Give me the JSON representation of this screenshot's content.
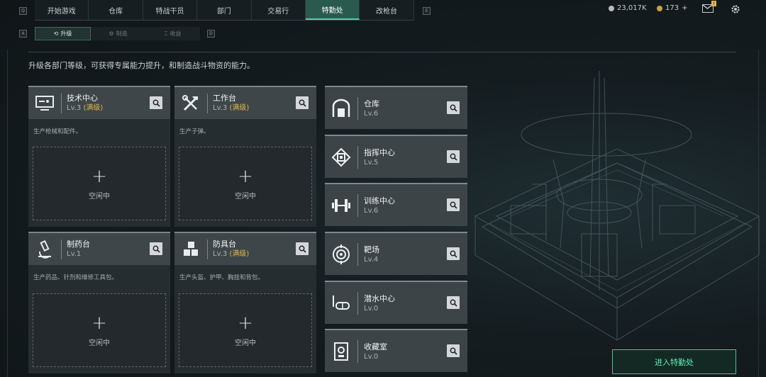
{
  "key_hints": {
    "left_tab": "Q",
    "right_tab": "E",
    "left_sub": "A",
    "right_sub": "D"
  },
  "top_tabs": [
    {
      "label": "开始游戏",
      "active": false
    },
    {
      "label": "仓库",
      "active": false
    },
    {
      "label": "特战干员",
      "active": false
    },
    {
      "label": "部门",
      "active": false
    },
    {
      "label": "交易行",
      "active": false
    },
    {
      "label": "特勤处",
      "active": true
    },
    {
      "label": "改枪台",
      "active": false
    }
  ],
  "currency": {
    "coins": "23,017K",
    "tickets": "173",
    "tickets_plus": "+",
    "mail_badge": "!"
  },
  "sub_tabs": [
    {
      "label": "升级",
      "icon": "upgrade-icon",
      "active": true
    },
    {
      "label": "制造",
      "icon": "craft-icon",
      "active": false
    },
    {
      "label": "收益",
      "icon": "income-icon",
      "active": false
    }
  ],
  "description": "升级各部门等级，可获得专属能力提升，和制造战斗物资的能力。",
  "production_cards": [
    {
      "name": "技术中心",
      "level": "Lv.3",
      "max_label": "(满级)",
      "desc": "生产枪械和配件。",
      "icon": "monitor-icon",
      "status": "空闲中"
    },
    {
      "name": "工作台",
      "level": "Lv.3",
      "max_label": "(满级)",
      "desc": "生产子弹。",
      "icon": "tools-icon",
      "status": "空闲中"
    },
    {
      "name": "制药台",
      "level": "Lv.1",
      "max_label": "",
      "desc": "生产药品、针剂和维修工具包。",
      "icon": "microscope-icon",
      "status": "空闲中"
    },
    {
      "name": "防具台",
      "level": "Lv.3",
      "max_label": "(满级)",
      "desc": "生产头盔、护甲、胸挂和背包。",
      "icon": "cubes-icon",
      "status": "空闲中"
    }
  ],
  "facility_cards": [
    {
      "name": "仓库",
      "level": "Lv.6",
      "icon": "warehouse-icon"
    },
    {
      "name": "指挥中心",
      "level": "Lv.5",
      "icon": "chip-icon"
    },
    {
      "name": "训练中心",
      "level": "Lv.6",
      "icon": "dumbbell-icon"
    },
    {
      "name": "靶场",
      "level": "Lv.4",
      "icon": "target-icon"
    },
    {
      "name": "潜水中心",
      "level": "Lv.0",
      "icon": "dive-mask-icon"
    },
    {
      "name": "收藏室",
      "level": "Lv.0",
      "icon": "collection-icon"
    }
  ],
  "enter_button": "进入特勤处",
  "colors": {
    "accent": "#4ad3a4",
    "max_level": "#e0b64a",
    "active_tab": "#2a5a4e"
  }
}
